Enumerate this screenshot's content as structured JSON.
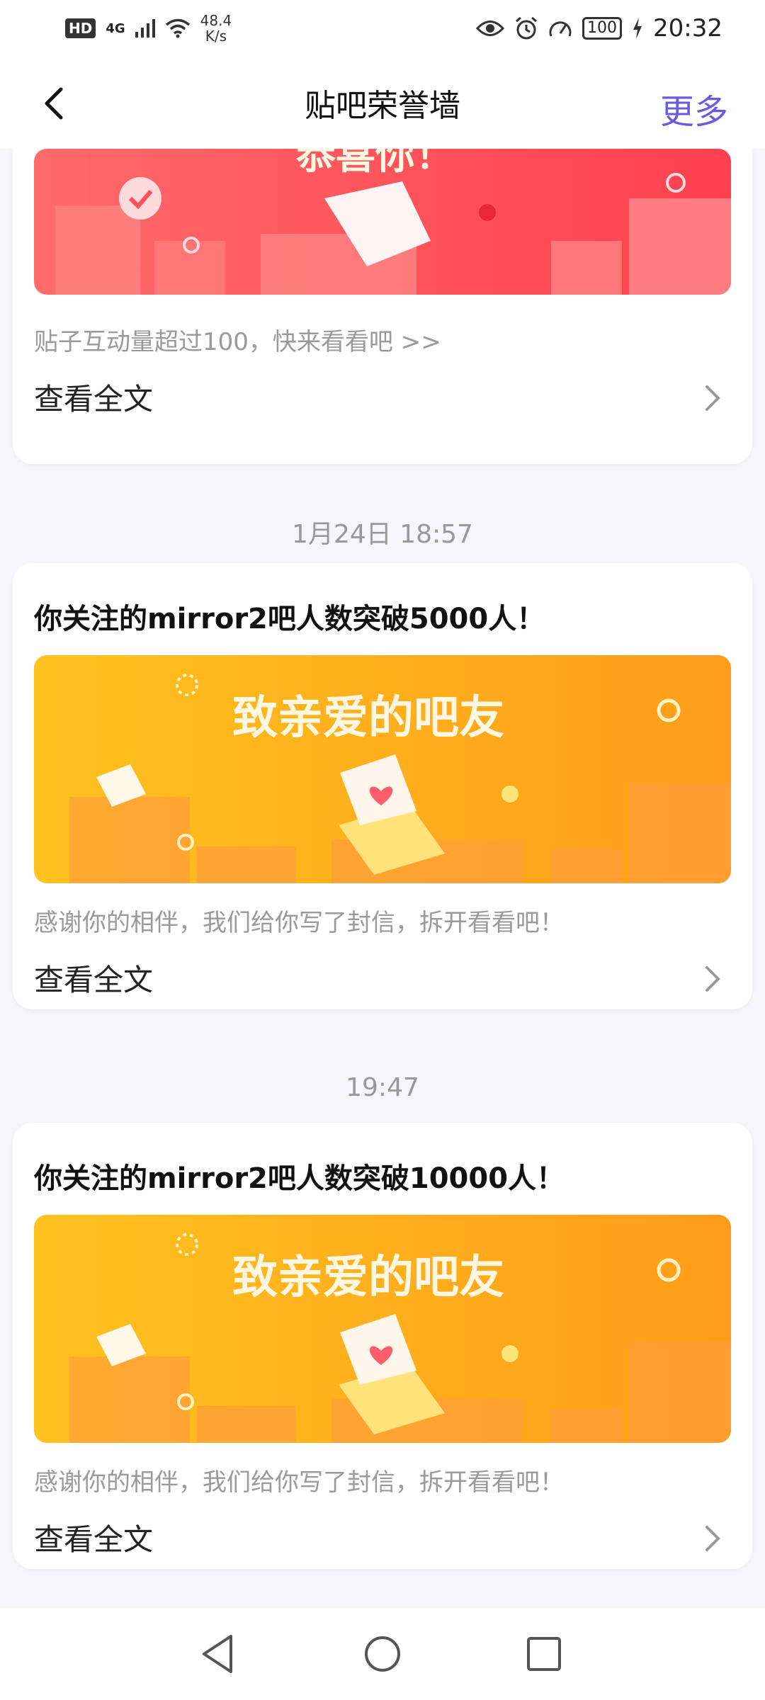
{
  "status_bar": {
    "hd": "HD",
    "network": "4G",
    "speed_value": "48.4",
    "speed_unit": "K/s",
    "battery": "100",
    "time": "20:32"
  },
  "header": {
    "title": "贴吧荣誉墙",
    "more_label": "更多"
  },
  "feed": {
    "card1": {
      "banner_text": "恭喜你！",
      "description": "贴子互动量超过100，快来看看吧 >>",
      "read_more": "查看全文"
    },
    "timestamp1": "1月24日 18:57",
    "card2": {
      "title": "你关注的mirror2吧人数突破5000人！",
      "banner_text": "致亲爱的吧友",
      "description": "感谢你的相伴，我们给你写了封信，拆开看看吧！",
      "read_more": "查看全文"
    },
    "timestamp2": "19:47",
    "card3": {
      "title": "你关注的mirror2吧人数突破10000人！",
      "banner_text": "致亲爱的吧友",
      "description": "感谢你的相伴，我们给你写了封信，拆开看看吧！",
      "read_more": "查看全文"
    }
  },
  "colors": {
    "accent": "#6a5ae0",
    "red_banner": "#ff4f59",
    "orange_banner": "#ffac1c"
  }
}
